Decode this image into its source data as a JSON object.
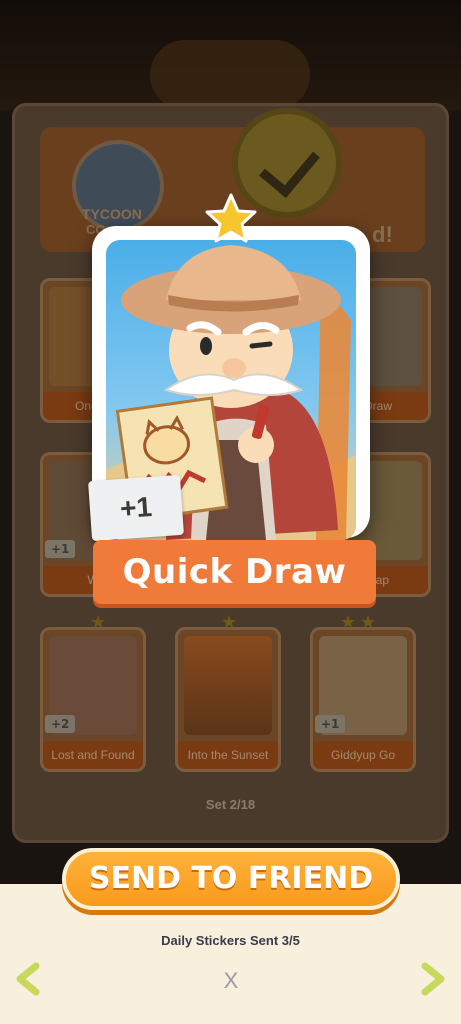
{
  "background": {
    "album_header_text": "TYCOON",
    "album_header_text2": "CO",
    "album_header_suffix": "d!",
    "cards": [
      {
        "label": "One M",
        "plus": ""
      },
      {
        "label": "Draw",
        "plus": ""
      },
      {
        "label": "W",
        "plus": "+1"
      },
      {
        "label": "Nap",
        "plus": ""
      },
      {
        "label": "Lost and Found",
        "plus": "+2"
      },
      {
        "label": "Into the Sunset",
        "plus": ""
      },
      {
        "label": "Giddyup Go",
        "plus": "+1"
      }
    ],
    "set_label": "Set 2/18"
  },
  "card": {
    "name": "Quick Draw",
    "count_tag": "+1",
    "stars": 1
  },
  "actions": {
    "send_label": "SEND TO FRIEND",
    "daily_status": "Daily Stickers Sent 3/5",
    "close_label": "X"
  },
  "colors": {
    "ribbon": "#f07a3a",
    "send_button": "#f99a1c",
    "panel": "#f9efdd",
    "arrow": "#c8d85a"
  }
}
